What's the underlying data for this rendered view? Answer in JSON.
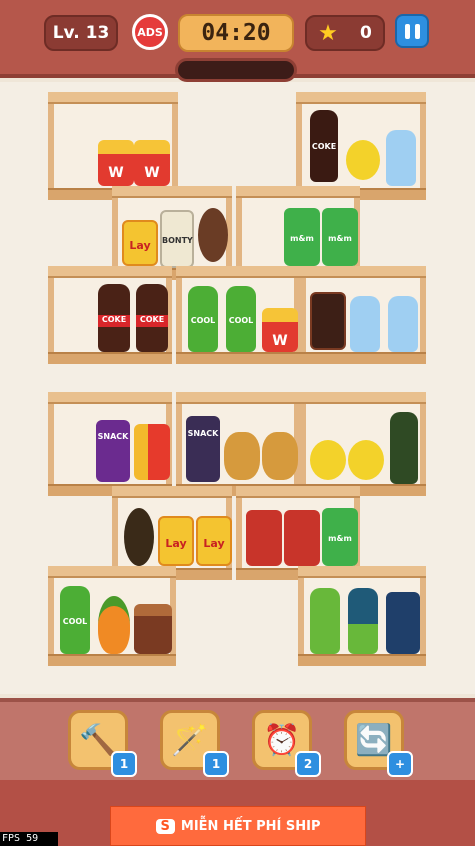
{
  "hud": {
    "level": "Lv. 13",
    "ads_badge": "ADS",
    "timer": "04:20",
    "stars_count": "0"
  },
  "colors": {
    "topbar": "#b5574b",
    "shelf_wood": "#e2b583",
    "booster_bg": "#f3c26f",
    "badge_blue": "#2e8fe0"
  },
  "items": {
    "fries": "W",
    "chips": "Lay",
    "cola": "COKE",
    "green_soda": "COOL",
    "snack": "SNACK",
    "bounty": "BONTY",
    "mm": "m&m"
  },
  "boosters": [
    {
      "name": "hammer",
      "icon": "🔨",
      "count": "1"
    },
    {
      "name": "magic-wand",
      "icon": "🪄",
      "count": "1"
    },
    {
      "name": "alarm-clock",
      "icon": "⏰",
      "count": "2"
    },
    {
      "name": "shuffle",
      "icon": "🔄",
      "count": "+"
    }
  ],
  "ad_banner": {
    "brand": "S",
    "text": "MIỄN HẾT PHÍ SHIP"
  },
  "fps": "FPS  59"
}
